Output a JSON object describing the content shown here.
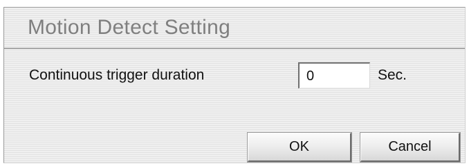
{
  "dialog": {
    "title": "Motion Detect Setting"
  },
  "form": {
    "duration_label": "Continuous trigger duration",
    "duration_value": "0",
    "unit_label": "Sec."
  },
  "buttons": {
    "ok_label": "OK",
    "cancel_label": "Cancel"
  }
}
